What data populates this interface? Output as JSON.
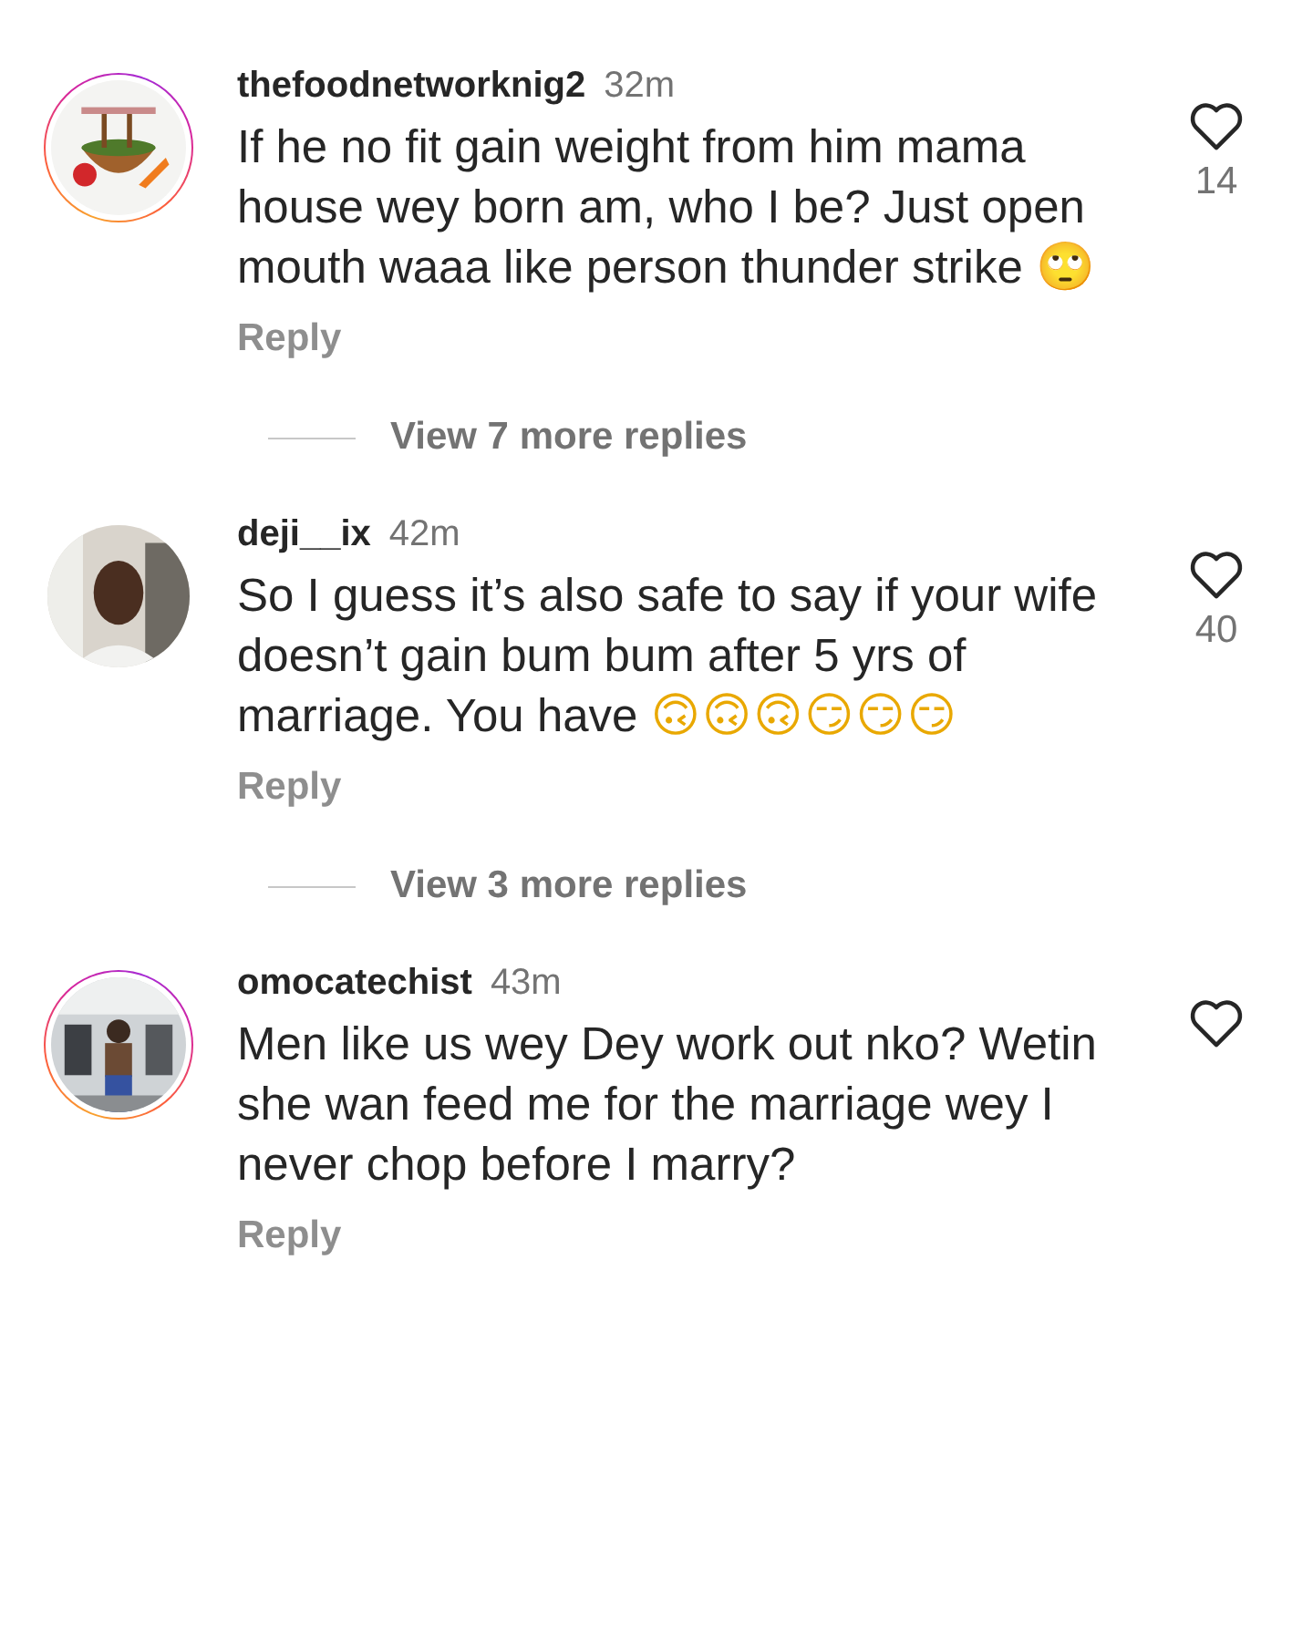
{
  "comments": [
    {
      "username": "thefoodnetworknig2",
      "time": "32m",
      "story_ring": true,
      "text": "If he no fit gain weight from him mama house wey born am, who I be? Just open mouth waaa like person thunder strike",
      "emoji": [
        "🙄"
      ],
      "likes": "14",
      "reply": "Reply",
      "view_replies": "View 7 more replies"
    },
    {
      "username": "deji__ix",
      "time": "42m",
      "story_ring": false,
      "text": "So I guess it’s also safe to say if your wife doesn’t gain bum bum after 5 yrs of marriage. You have",
      "emoji": [
        "🙃",
        "🙃",
        "🙃",
        "😏",
        "😏",
        "😏"
      ],
      "likes": "40",
      "reply": "Reply",
      "view_replies": "View 3 more replies"
    },
    {
      "username": "omocatechist",
      "time": "43m",
      "story_ring": true,
      "text": "Men like us wey Dey work out nko? Wetin she wan feed me for the marriage wey I never chop before I marry?",
      "reply": "Reply"
    }
  ]
}
